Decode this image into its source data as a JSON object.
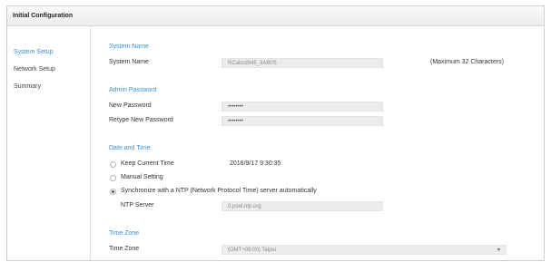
{
  "window": {
    "title": "Initial Configuration"
  },
  "sidebar": {
    "items": [
      {
        "label": "System Setup",
        "active": true
      },
      {
        "label": "Network Setup",
        "active": false
      },
      {
        "label": "Summary",
        "active": false
      }
    ]
  },
  "system_name": {
    "section_title": "System Name",
    "label": "System Name",
    "value": "RCabcd945_3AB0S",
    "hint": "(Maximum 32 Characters)"
  },
  "admin_password": {
    "section_title": "Admin Password",
    "new_label": "New Password",
    "new_value": "••••••••",
    "retype_label": "Retype New Password",
    "retype_value": "••••••••"
  },
  "date_time": {
    "section_title": "Date and Time",
    "keep_label": "Keep Current Time",
    "keep_value": "2016/9/17 9:30:35",
    "manual_label": "Manual Setting",
    "ntp_label": "Synchronize with a NTP (Network Protocol Time) server automatically",
    "selected": "ntp",
    "ntp_server_label": "NTP Server",
    "ntp_server_value": "0.pool.ntp.org"
  },
  "time_zone": {
    "section_title": "Time Zone",
    "label": "Time Zone",
    "value": "(GMT+08:00) Taipei"
  }
}
